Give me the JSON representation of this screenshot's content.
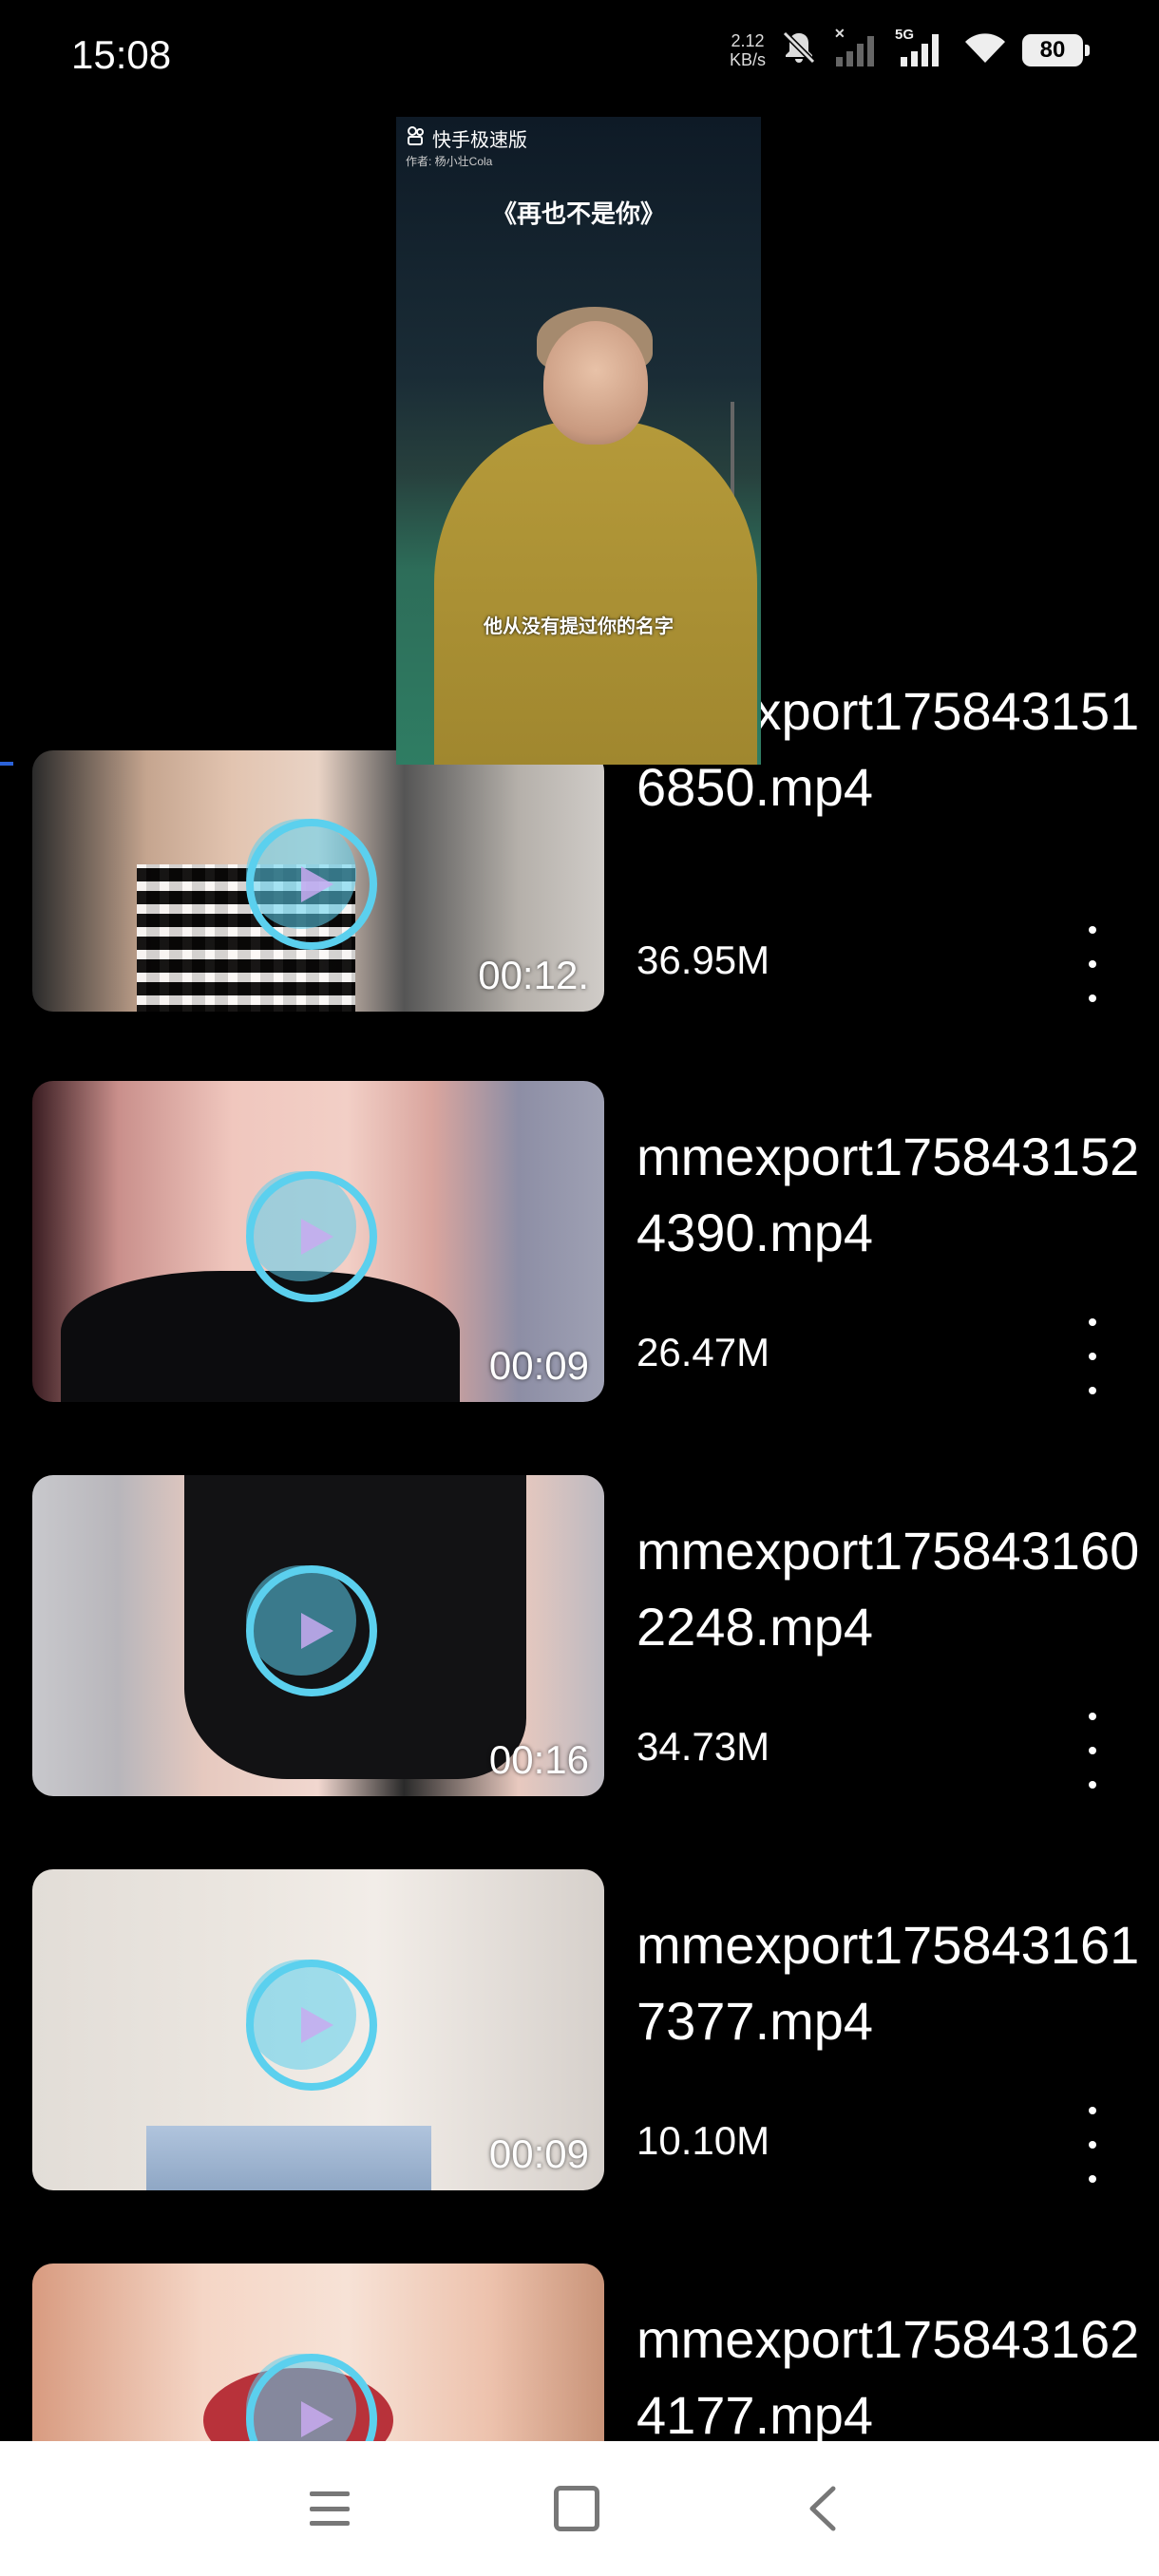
{
  "status_bar": {
    "time": "15:08",
    "net_speed_value": "2.12",
    "net_speed_unit": "KB/s",
    "network_type": "5G",
    "battery": "80"
  },
  "preview": {
    "app_name": "快手极速版",
    "author": "作者: 杨小壮Cola",
    "title": "《再也不是你》",
    "caption": "他从没有提过你的名字"
  },
  "videos": [
    {
      "file_name": "mmexport1758431516850.mp4",
      "duration": "00:12.",
      "size": "36.95M"
    },
    {
      "file_name": "mmexport1758431524390.mp4",
      "duration": "00:09",
      "size": "26.47M"
    },
    {
      "file_name": "mmexport1758431602248.mp4",
      "duration": "00:16",
      "size": "34.73M"
    },
    {
      "file_name": "mmexport1758431617377.mp4",
      "duration": "00:09",
      "size": "10.10M"
    },
    {
      "file_name": "mmexport1758431624177.mp4",
      "duration": "",
      "size": ""
    }
  ],
  "colors": {
    "background": "#000000",
    "play_ring": "#5bd0ee",
    "nav_bar": "#ffffff"
  },
  "icons": {
    "play": "play-icon",
    "more": "more-vertical-icon",
    "menu": "menu-icon",
    "home": "home-icon",
    "back": "back-icon"
  }
}
